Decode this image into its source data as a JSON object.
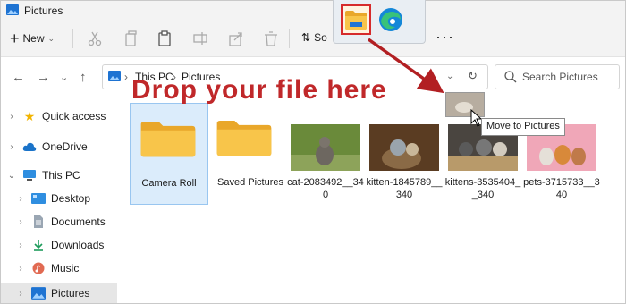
{
  "window": {
    "title": "Pictures"
  },
  "toolbar": {
    "new_label": "New",
    "sort_label": "So",
    "more_label": "···"
  },
  "address": {
    "crumbs": [
      "This PC",
      "Pictures"
    ],
    "search_placeholder": "Search Pictures"
  },
  "sidebar": {
    "items": [
      {
        "label": "Quick access"
      },
      {
        "label": "OneDrive"
      },
      {
        "label": "This PC"
      },
      {
        "label": "Desktop"
      },
      {
        "label": "Documents"
      },
      {
        "label": "Downloads"
      },
      {
        "label": "Music"
      },
      {
        "label": "Pictures"
      }
    ]
  },
  "files": [
    {
      "name": "Camera Roll"
    },
    {
      "name": "Saved Pictures"
    },
    {
      "name": "cat-2083492__340"
    },
    {
      "name": "kitten-1845789__340"
    },
    {
      "name": "kittens-3535404__340"
    },
    {
      "name": "pets-3715733__340"
    }
  ],
  "overlay": {
    "drop_text": "Drop your file here",
    "tooltip": "Move to Pictures"
  },
  "colors": {
    "accent_red": "#c0282a",
    "folder_yellow": "#f8c54a",
    "selection_blue": "#dbecfb"
  }
}
